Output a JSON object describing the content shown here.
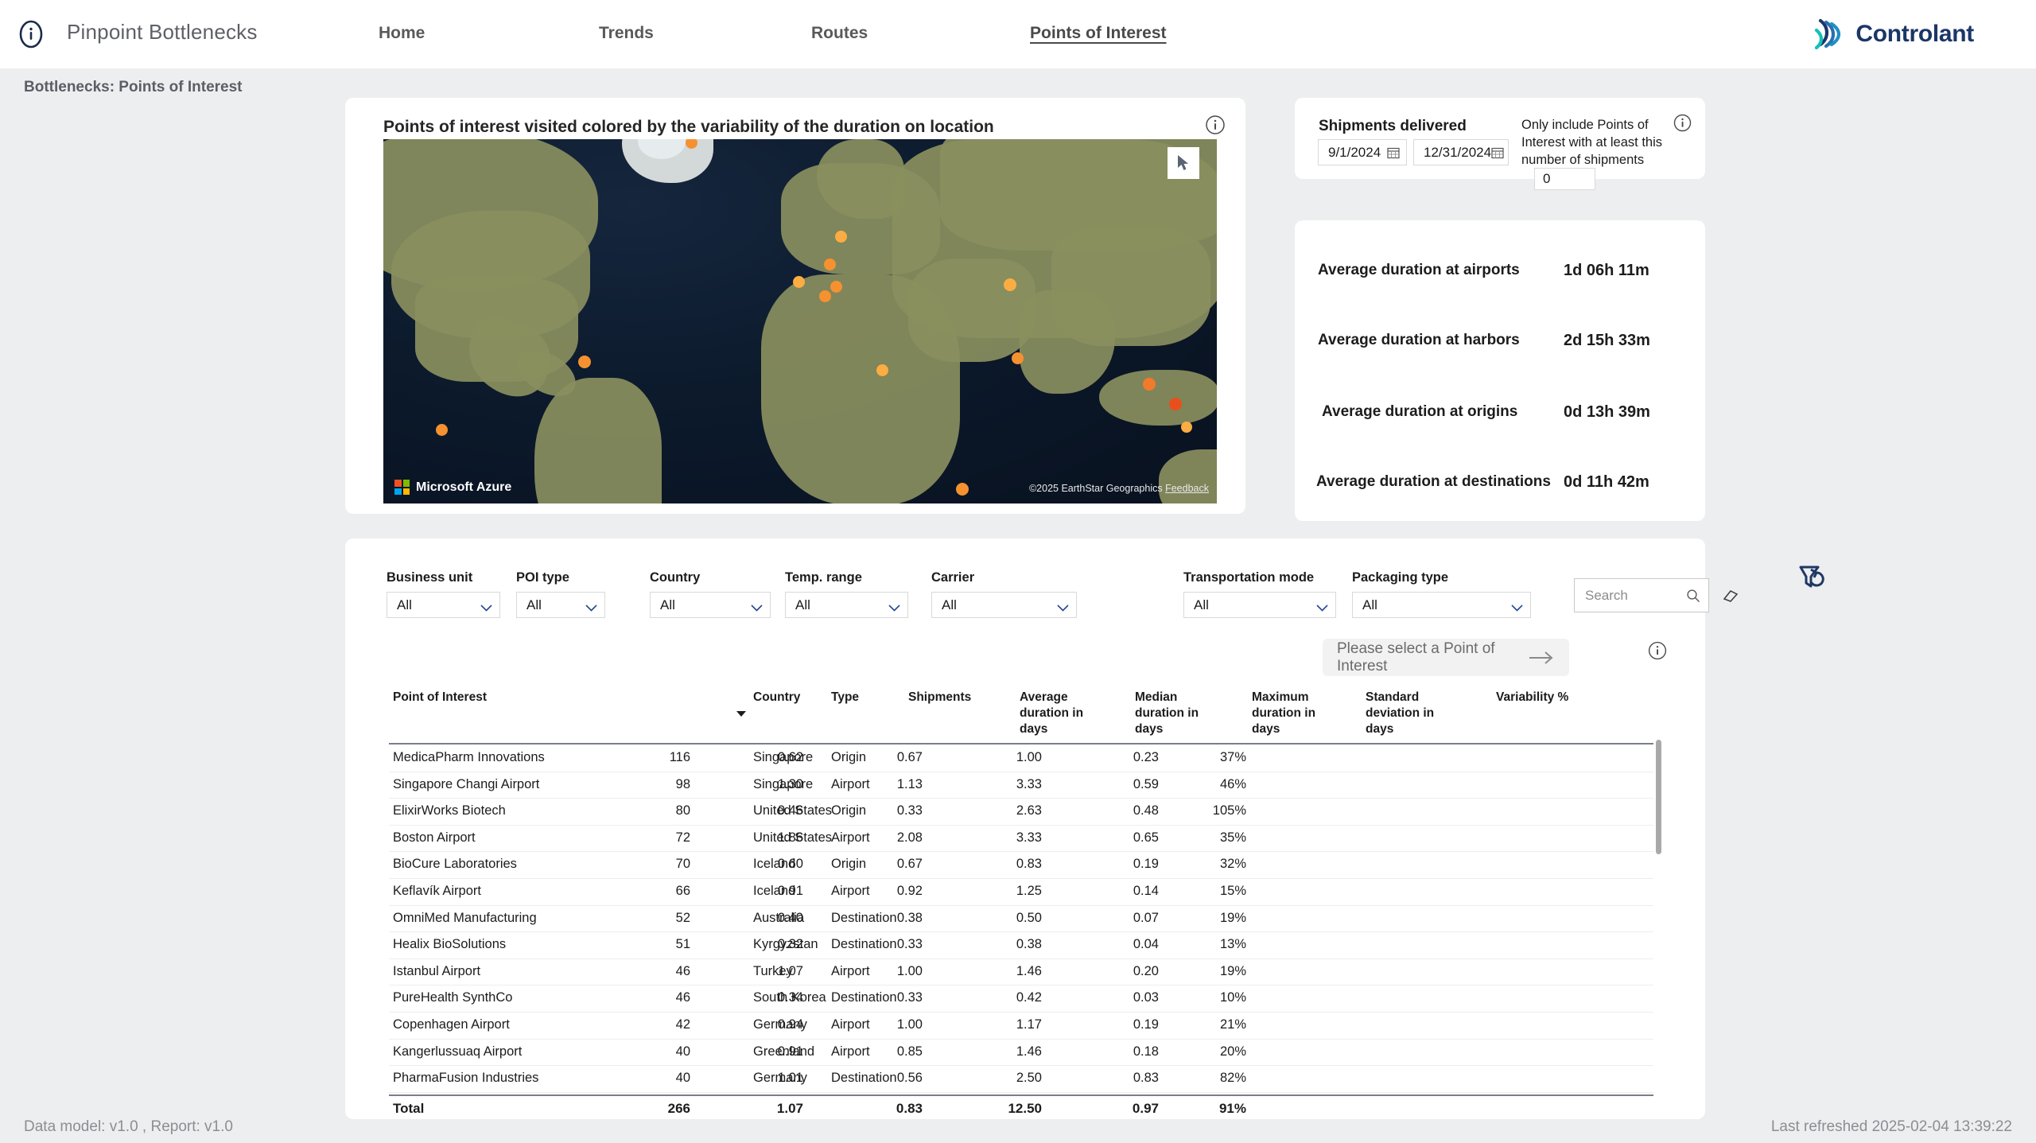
{
  "header": {
    "info_icon": "info-circle-icon",
    "title": "Pinpoint Bottlenecks",
    "nav": [
      {
        "label": "Home",
        "active": false
      },
      {
        "label": "Trends",
        "active": false
      },
      {
        "label": "Routes",
        "active": false
      },
      {
        "label": "Points of Interest",
        "active": true
      }
    ],
    "logo_text": "Controlant"
  },
  "breadcrumb": "Bottlenecks: Points of Interest",
  "map": {
    "title": "Points of interest visited colored by the variability of the duration on location",
    "info_icon": "info-circle-icon",
    "provider": "Microsoft Azure",
    "attribution": "©2025 EarthStar Geographics",
    "feedback": "Feedback",
    "cursor_icon": "cursor-arrow-icon"
  },
  "shipments_panel": {
    "title": "Shipments delivered",
    "date_from": "9/1/2024",
    "date_to": "12/31/2024",
    "date_icon": "calendar-icon",
    "min_shipments_label": "Only include Points of Interest with at least this number of shipments",
    "min_shipments_value": "0",
    "info_icon": "info-circle-icon"
  },
  "kpis": [
    {
      "label": "Average duration at airports",
      "value": "1d 06h 11m"
    },
    {
      "label": "Average duration at harbors",
      "value": "2d 15h 33m"
    },
    {
      "label": "Average duration at origins",
      "value": "0d 13h 39m"
    },
    {
      "label": "Average duration at destinations",
      "value": "0d 11h 42m"
    }
  ],
  "filters": [
    {
      "label": "Business unit",
      "value": "All"
    },
    {
      "label": "POI type",
      "value": "All"
    },
    {
      "label": "Country",
      "value": "All"
    },
    {
      "label": "Temp. range",
      "value": "All"
    },
    {
      "label": "Carrier",
      "value": "All"
    },
    {
      "label": "Transportation mode",
      "value": "All"
    },
    {
      "label": "Packaging type",
      "value": "All"
    }
  ],
  "search": {
    "placeholder": "Search",
    "value": "",
    "icon": "search-icon",
    "clear_icon": "eraser-icon"
  },
  "filter_reset_icon": "clear-filters-icon",
  "select_poi": {
    "label": "Please select a Point of Interest",
    "icon": "arrow-right-icon"
  },
  "table_info_icon": "info-circle-icon",
  "table": {
    "columns": [
      "Point of Interest",
      "Country",
      "Type",
      "Shipments",
      "Average duration in days",
      "Median duration in days",
      "Maximum duration in days",
      "Standard deviation in days",
      "Variability %"
    ],
    "sorted_by": "Shipments",
    "sort_direction": "desc",
    "rows": [
      {
        "poi": "MedicaPharm Innovations",
        "country": "Singapore",
        "type": "Origin",
        "shipments": "116",
        "avg": "0.62",
        "median": "0.67",
        "max": "1.00",
        "std": "0.23",
        "variability": "37%"
      },
      {
        "poi": "Singapore Changi Airport",
        "country": "Singapore",
        "type": "Airport",
        "shipments": "98",
        "avg": "1.30",
        "median": "1.13",
        "max": "3.33",
        "std": "0.59",
        "variability": "46%"
      },
      {
        "poi": "ElixirWorks Biotech",
        "country": "United States",
        "type": "Origin",
        "shipments": "80",
        "avg": "0.46",
        "median": "0.33",
        "max": "2.63",
        "std": "0.48",
        "variability": "105%"
      },
      {
        "poi": "Boston Airport",
        "country": "United States",
        "type": "Airport",
        "shipments": "72",
        "avg": "1.86",
        "median": "2.08",
        "max": "3.33",
        "std": "0.65",
        "variability": "35%"
      },
      {
        "poi": "BioCure Laboratories",
        "country": "Iceland",
        "type": "Origin",
        "shipments": "70",
        "avg": "0.60",
        "median": "0.67",
        "max": "0.83",
        "std": "0.19",
        "variability": "32%"
      },
      {
        "poi": "Keflavík Airport",
        "country": "Iceland",
        "type": "Airport",
        "shipments": "66",
        "avg": "0.91",
        "median": "0.92",
        "max": "1.25",
        "std": "0.14",
        "variability": "15%"
      },
      {
        "poi": "OmniMed Manufacturing",
        "country": "Australia",
        "type": "Destination",
        "shipments": "52",
        "avg": "0.40",
        "median": "0.38",
        "max": "0.50",
        "std": "0.07",
        "variability": "19%"
      },
      {
        "poi": "Healix BioSolutions",
        "country": "Kyrgyzstan",
        "type": "Destination",
        "shipments": "51",
        "avg": "0.32",
        "median": "0.33",
        "max": "0.38",
        "std": "0.04",
        "variability": "13%"
      },
      {
        "poi": "Istanbul Airport",
        "country": "Turkey",
        "type": "Airport",
        "shipments": "46",
        "avg": "1.07",
        "median": "1.00",
        "max": "1.46",
        "std": "0.20",
        "variability": "19%"
      },
      {
        "poi": "PureHealth SynthCo",
        "country": "South Korea",
        "type": "Destination",
        "shipments": "46",
        "avg": "0.34",
        "median": "0.33",
        "max": "0.42",
        "std": "0.03",
        "variability": "10%"
      },
      {
        "poi": "Copenhagen Airport",
        "country": "Germany",
        "type": "Airport",
        "shipments": "42",
        "avg": "0.94",
        "median": "1.00",
        "max": "1.17",
        "std": "0.19",
        "variability": "21%"
      },
      {
        "poi": "Kangerlussuaq Airport",
        "country": "Greenland",
        "type": "Airport",
        "shipments": "40",
        "avg": "0.91",
        "median": "0.85",
        "max": "1.46",
        "std": "0.18",
        "variability": "20%"
      },
      {
        "poi": "PharmaFusion Industries",
        "country": "Germany",
        "type": "Destination",
        "shipments": "40",
        "avg": "1.01",
        "median": "0.56",
        "max": "2.50",
        "std": "0.83",
        "variability": "82%"
      }
    ],
    "total": {
      "label": "Total",
      "shipments": "266",
      "avg": "1.07",
      "median": "0.83",
      "max": "12.50",
      "std": "0.97",
      "variability": "91%"
    }
  },
  "footer": {
    "left": "Data model: v1.0 , Report: v1.0",
    "right": "Last refreshed 2025-02-04 13:39:22"
  },
  "colors": {
    "page_bg": "#eceef0",
    "card_bg": "#ffffff",
    "brand_navy": "#1b3668",
    "marker_orange": "#f6912f",
    "marker_light": "#fbb040",
    "marker_red": "#ea5a22"
  }
}
